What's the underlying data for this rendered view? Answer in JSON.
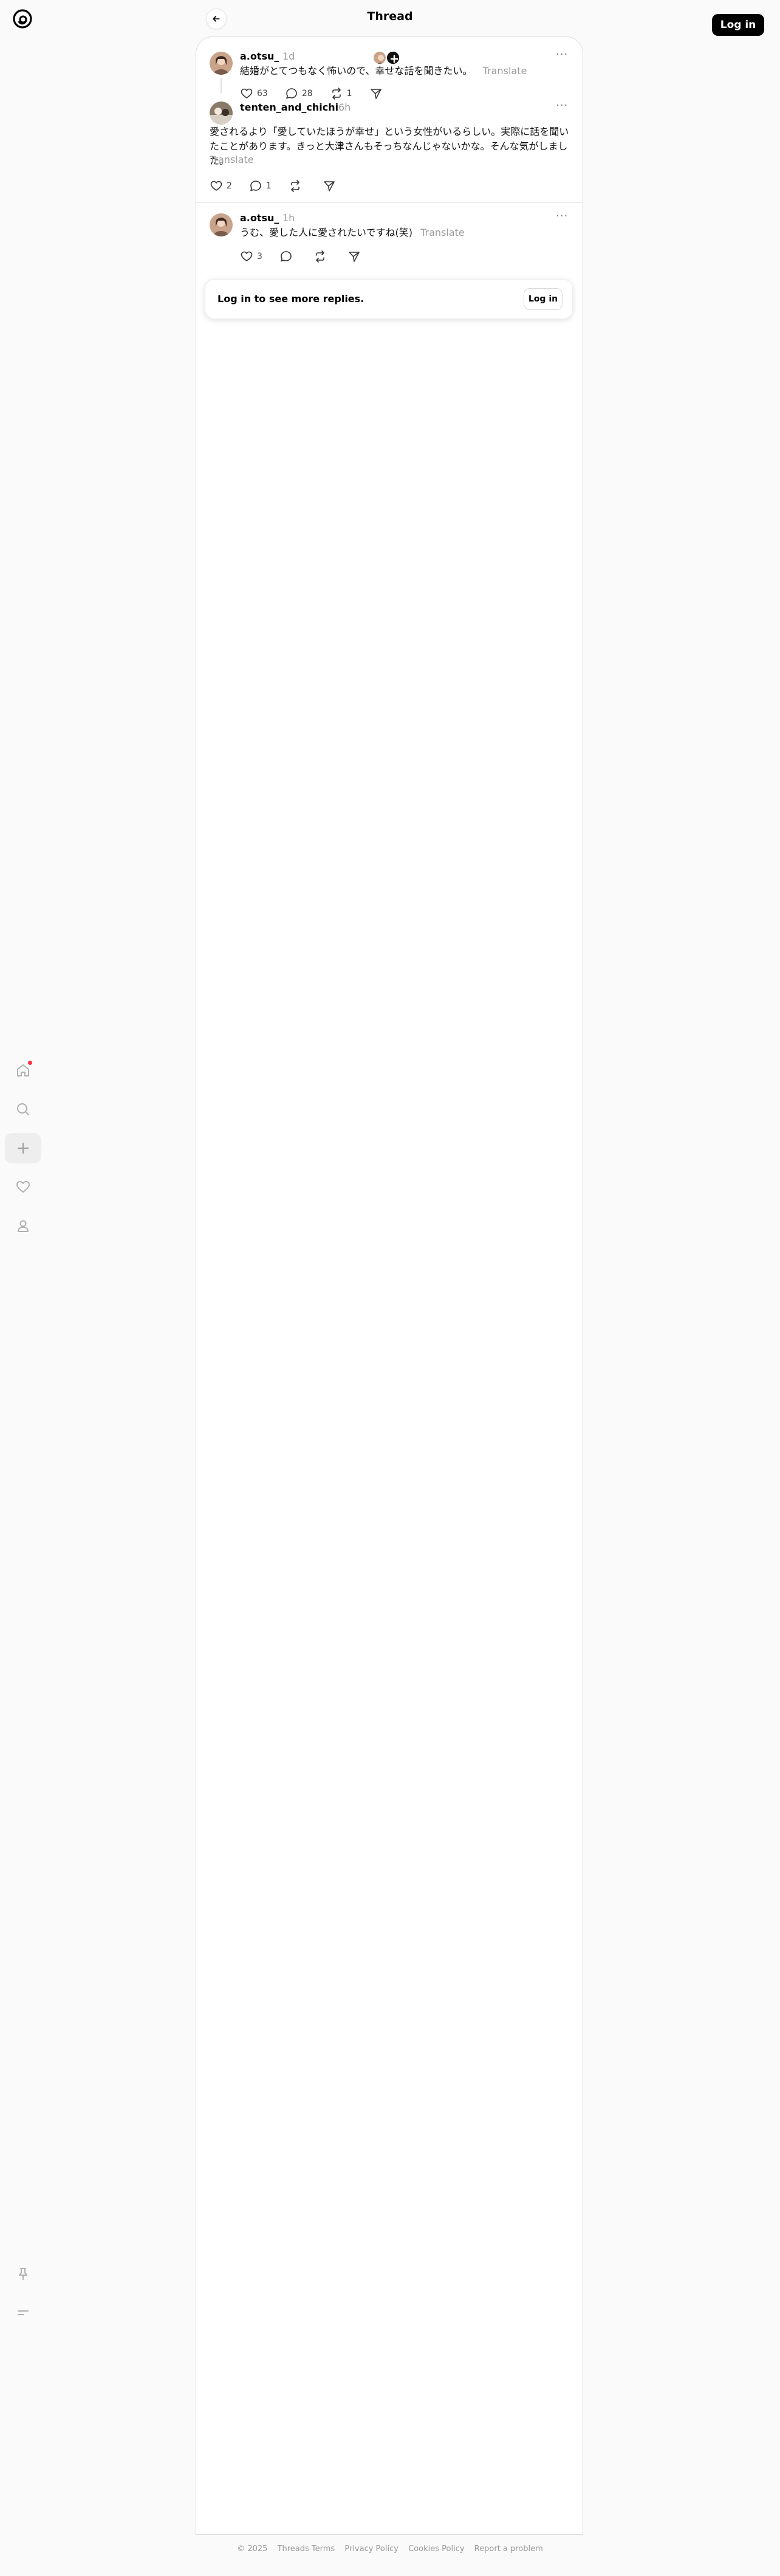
{
  "header": {
    "title": "Thread",
    "login_label": "Log in"
  },
  "nav": {
    "items": [
      {
        "name": "home-icon",
        "badge": true
      },
      {
        "name": "search-icon"
      },
      {
        "name": "create-icon",
        "active": true
      },
      {
        "name": "heart-icon"
      },
      {
        "name": "profile-icon"
      }
    ],
    "bottom": [
      {
        "name": "pin-icon"
      },
      {
        "name": "menu-icon"
      }
    ]
  },
  "posts": [
    {
      "username": "a.otsu_",
      "time": "1d",
      "text": "結婚がとてつもなく怖いので、幸せな話を聞きたい。",
      "translate": "Translate",
      "likes": "63",
      "replies": "28",
      "reposts": "1"
    },
    {
      "username": "tenten_and_chichi",
      "time": "6h",
      "text": "愛されるより「愛していたほうが幸せ」という女性がいるらしい。実際に話を聞いたことがあります。きっと大津さんもそっちなんじゃないかな。そんな気がしました。",
      "translate": "Translate",
      "likes": "2",
      "replies": "1"
    },
    {
      "username": "a.otsu_",
      "time": "1h",
      "text": "うむ、愛した人に愛されたいですね(笑)",
      "translate": "Translate",
      "likes": "3"
    }
  ],
  "login_card": {
    "text": "Log in to see more replies.",
    "button": "Log in"
  },
  "footer": {
    "copyright": "© 2025",
    "links": [
      "Threads Terms",
      "Privacy Policy",
      "Cookies Policy",
      "Report a problem"
    ]
  },
  "colors": {
    "accent": "#000000",
    "badge": "#ff3040",
    "muted": "#999999"
  }
}
